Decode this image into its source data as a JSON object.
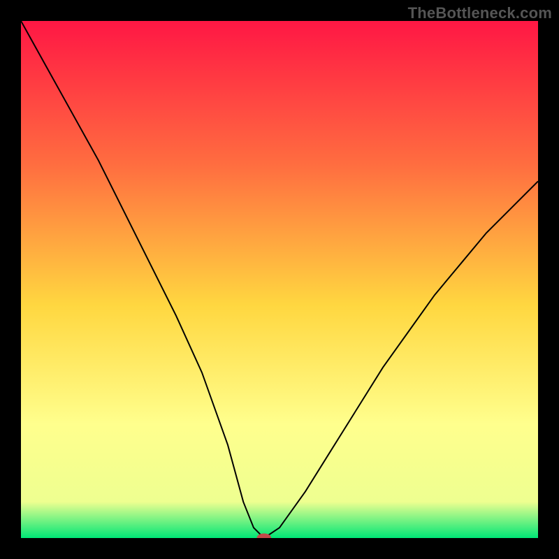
{
  "watermark": "TheBottleneck.com",
  "chart_data": {
    "type": "line",
    "title": "",
    "xlabel": "",
    "ylabel": "",
    "xlim": [
      0,
      100
    ],
    "ylim": [
      0,
      100
    ],
    "gradient_stops": [
      {
        "offset": 0,
        "color": "#ff1744"
      },
      {
        "offset": 28,
        "color": "#ff6e40"
      },
      {
        "offset": 55,
        "color": "#ffd740"
      },
      {
        "offset": 78,
        "color": "#ffff8d"
      },
      {
        "offset": 93,
        "color": "#eeff90"
      },
      {
        "offset": 100,
        "color": "#00e676"
      }
    ],
    "series": [
      {
        "name": "bottleneck-curve",
        "x": [
          0,
          5,
          10,
          15,
          20,
          25,
          30,
          35,
          40,
          43,
          45,
          47,
          50,
          55,
          60,
          65,
          70,
          75,
          80,
          85,
          90,
          95,
          100
        ],
        "y": [
          100,
          91,
          82,
          73,
          63,
          53,
          43,
          32,
          18,
          7,
          2,
          0,
          2,
          9,
          17,
          25,
          33,
          40,
          47,
          53,
          59,
          64,
          69
        ]
      }
    ],
    "marker": {
      "x": 47,
      "y": 0,
      "rx": 1.4,
      "ry": 0.9,
      "color": "#c24a4a"
    }
  }
}
